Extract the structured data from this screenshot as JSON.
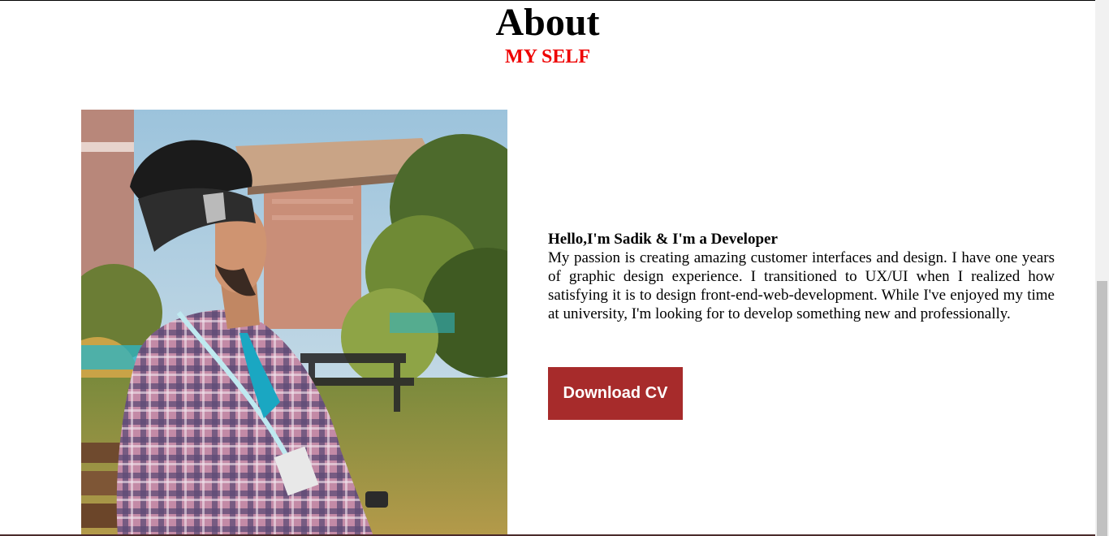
{
  "about": {
    "title": "About",
    "subtitle": "MY SELF"
  },
  "intro": {
    "greeting": "Hello,I'm Sadik & I'm a Developer",
    "description": "My passion is creating amazing customer interfaces and design. I have one years of graphic design experience. I transitioned to UX/UI when I realized how satisfying it is to design front-end-web-development. While I've enjoyed my time at university, I'm looking for to develop something new and professionally."
  },
  "actions": {
    "download_label": "Download CV"
  },
  "colors": {
    "accent_red": "#ee0000",
    "button_bg": "#a72b2b"
  }
}
